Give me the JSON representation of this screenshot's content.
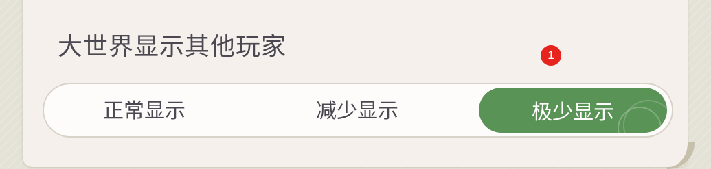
{
  "section": {
    "title": "大世界显示其他玩家",
    "badge_count": "1"
  },
  "display_options": {
    "options": [
      "正常显示",
      "减少显示",
      "极少显示"
    ],
    "selected": "极少显示",
    "selected_color": "#5a9356"
  }
}
